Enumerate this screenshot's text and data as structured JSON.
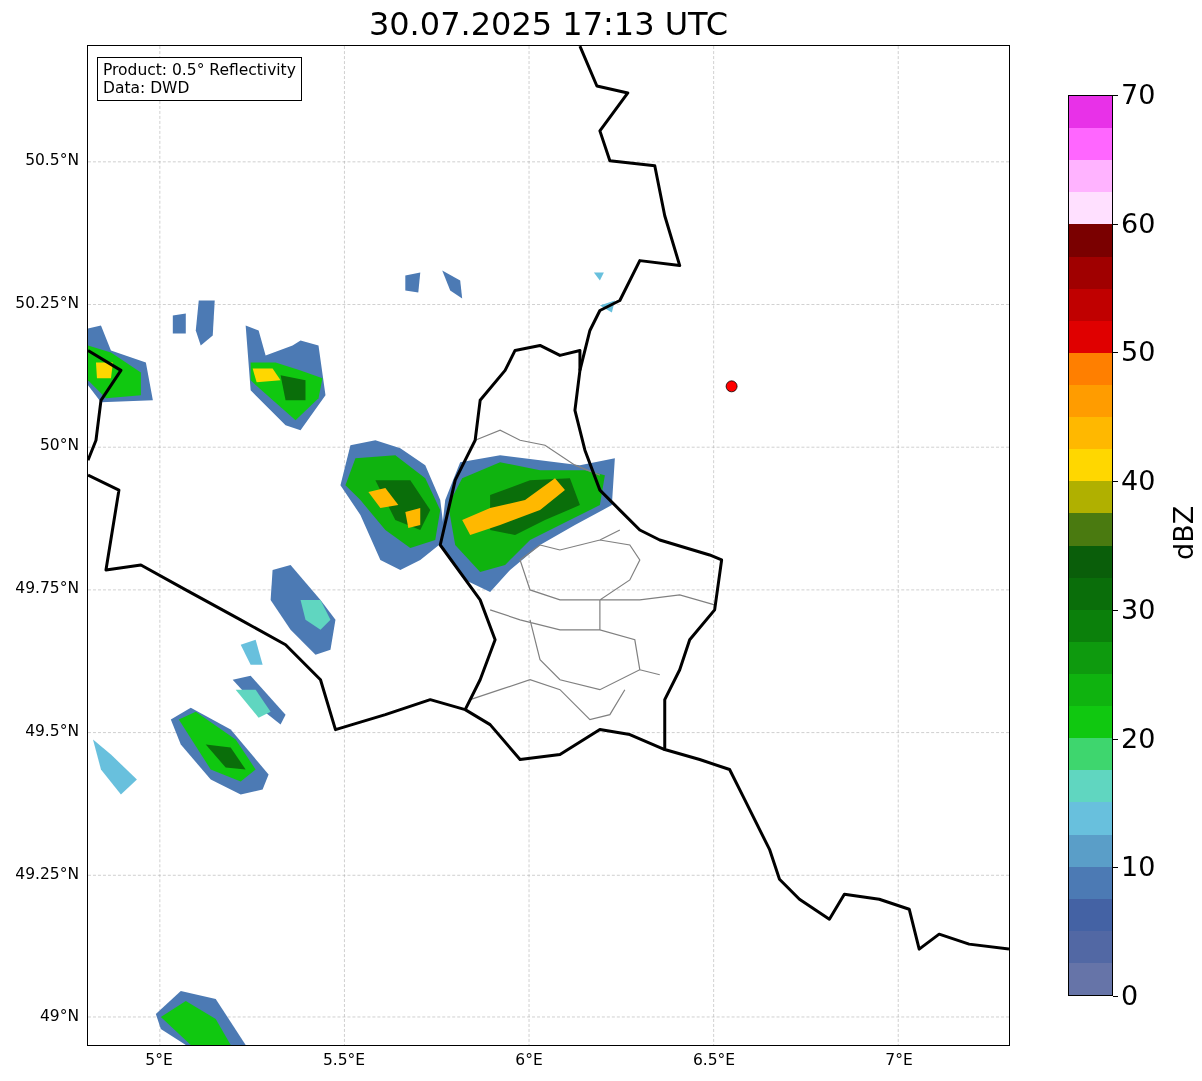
{
  "title": "30.07.2025 17:13 UTC",
  "info_box": {
    "lines": [
      "Product: 0.5° Reflectivity",
      "Data: DWD"
    ]
  },
  "map": {
    "latitude_labels": [
      "50.5°N",
      "50.25°N",
      "50°N",
      "49.75°N",
      "49.5°N",
      "49.25°N",
      "49°N"
    ],
    "longitude_labels": [
      "5°E",
      "5.5°E",
      "6°E",
      "6.5°E",
      "7°E"
    ]
  },
  "colorbar": {
    "label": "dBZ",
    "tick_labels": [
      "70",
      "60",
      "50",
      "40",
      "30",
      "20",
      "10",
      "0"
    ],
    "segments": [
      {
        "color": "#e831e8"
      },
      {
        "color": "#ff66ff"
      },
      {
        "color": "#ffb3ff"
      },
      {
        "color": "#ffe0ff"
      },
      {
        "color": "#7a0000"
      },
      {
        "color": "#a00000"
      },
      {
        "color": "#c00000"
      },
      {
        "color": "#e00000"
      },
      {
        "color": "#ff7f00"
      },
      {
        "color": "#ff9c00"
      },
      {
        "color": "#ffb800"
      },
      {
        "color": "#ffd700"
      },
      {
        "color": "#b0b000"
      },
      {
        "color": "#4a7a10"
      },
      {
        "color": "#0a5e0a"
      },
      {
        "color": "#0a6e0a"
      },
      {
        "color": "#0b800b"
      },
      {
        "color": "#0e9a0e"
      },
      {
        "color": "#0fb30f"
      },
      {
        "color": "#10c810"
      },
      {
        "color": "#3ed66e"
      },
      {
        "color": "#60d6c0"
      },
      {
        "color": "#68c0dd"
      },
      {
        "color": "#5a9ec8"
      },
      {
        "color": "#4c7ab4"
      },
      {
        "color": "#4462a4"
      },
      {
        "color": "#5268a4"
      },
      {
        "color": "#6674a8"
      }
    ]
  }
}
